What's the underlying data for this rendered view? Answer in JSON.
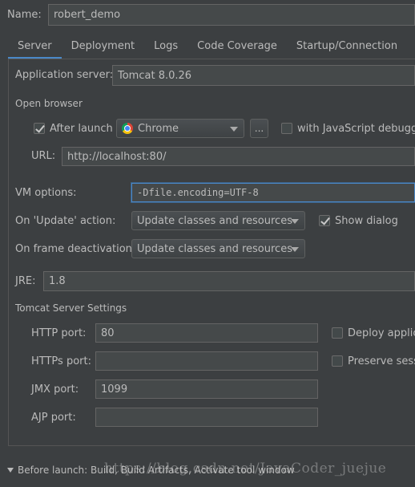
{
  "name": {
    "label": "Name:",
    "value": "robert_demo"
  },
  "tabs": [
    {
      "label": "Server",
      "active": true
    },
    {
      "label": "Deployment",
      "active": false
    },
    {
      "label": "Logs",
      "active": false
    },
    {
      "label": "Code Coverage",
      "active": false
    },
    {
      "label": "Startup/Connection",
      "active": false
    }
  ],
  "server": {
    "app_server_label": "Application server:",
    "app_server_value": "Tomcat 8.0.26",
    "open_browser_title": "Open browser",
    "after_launch_label": "After launch",
    "after_launch_checked": true,
    "browser_value": "Chrome",
    "browse_button": "...",
    "js_debugger_label": "with JavaScript debugger",
    "js_debugger_checked": false,
    "url_label": "URL:",
    "url_value": "http://localhost:80/",
    "vm_options_label": "VM options:",
    "vm_options_value": "-Dfile.encoding=UTF-8",
    "on_update_label": "On 'Update' action:",
    "on_update_value": "Update classes and resources",
    "show_dialog_label": "Show dialog",
    "show_dialog_checked": true,
    "on_frame_label": "On frame deactivation:",
    "on_frame_value": "Update classes and resources",
    "jre_label": "JRE:",
    "jre_value": "1.8",
    "tomcat_settings_title": "Tomcat Server Settings",
    "http_port_label": "HTTP port:",
    "http_port_value": "80",
    "deploy_label": "Deploy applica",
    "deploy_checked": false,
    "https_port_label": "HTTPs port:",
    "https_port_value": "",
    "preserve_label": "Preserve sessi",
    "preserve_checked": false,
    "jmx_port_label": "JMX port:",
    "jmx_port_value": "1099",
    "ajp_port_label": "AJP port:",
    "ajp_port_value": ""
  },
  "before_launch": {
    "label": "Before launch: Build, Build Artifacts, Activate tool window"
  },
  "watermark": "https://blog.csdn.net/JavaCoder_juejue",
  "colors": {
    "background": "#3c3f41",
    "field": "#45494a",
    "focus": "#4a88c7",
    "text": "#bbbbbb"
  }
}
